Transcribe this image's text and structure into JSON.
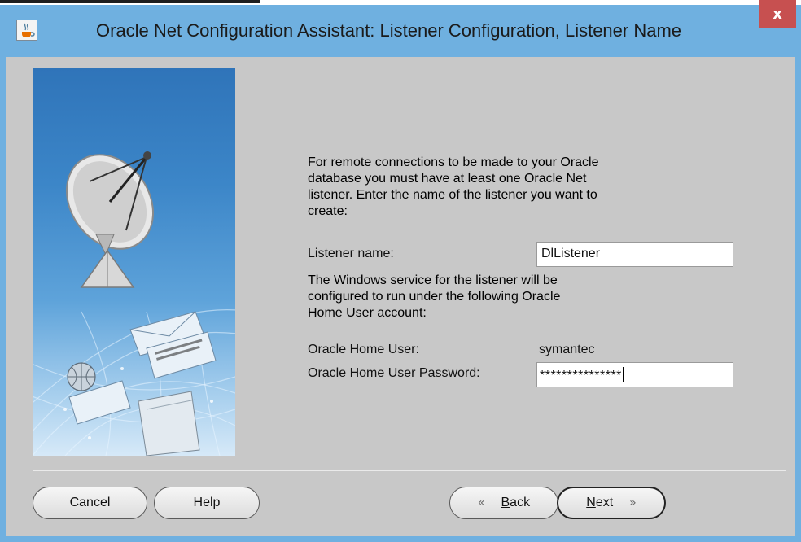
{
  "window": {
    "title": "Oracle Net Configuration Assistant: Listener Configuration, Listener Name",
    "close_label": "x",
    "app_icon": "java-cup-icon"
  },
  "banner": {
    "image": "satellite-dish-illustration"
  },
  "content": {
    "intro_lines": [
      "For remote connections to be made to your Oracle",
      "database you must have at least one Oracle Net",
      "listener. Enter the name of the listener you want to",
      "create:"
    ],
    "listener_name_label": "Listener name:",
    "listener_name_value": "DlListener",
    "service_lines": [
      "The Windows service for the listener will be",
      "configured to run under the following Oracle",
      "Home User account:"
    ],
    "home_user_label": "Oracle Home User:",
    "home_user_value": "symantec",
    "password_label": "Oracle Home User Password:",
    "password_value": "***************"
  },
  "buttons": {
    "cancel": "Cancel",
    "help": "Help",
    "back_glyph": "«",
    "back_mnemonic": "B",
    "back_rest": "ack",
    "next_mnemonic": "N",
    "next_rest": "ext",
    "next_glyph": "»"
  },
  "colors": {
    "titlebar": "#6fb0e0",
    "client": "#c8c8c8",
    "close": "#c75050"
  }
}
